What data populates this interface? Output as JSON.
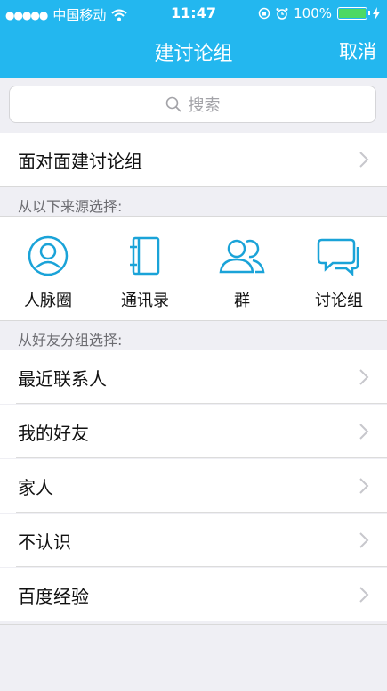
{
  "status_bar": {
    "carrier": "中国移动",
    "time": "11:47",
    "battery": "100%",
    "battery_level": 1.0
  },
  "nav": {
    "title": "建讨论组",
    "cancel": "取消"
  },
  "search": {
    "placeholder": "搜索"
  },
  "face_to_face": {
    "label": "面对面建讨论组"
  },
  "sources": {
    "header": "从以下来源选择:",
    "items": [
      {
        "label": "人脉圈",
        "icon": "contacts-circle-icon"
      },
      {
        "label": "通讯录",
        "icon": "address-book-icon"
      },
      {
        "label": "群",
        "icon": "group-icon"
      },
      {
        "label": "讨论组",
        "icon": "chat-bubbles-icon"
      }
    ]
  },
  "friends": {
    "header": "从好友分组选择:",
    "groups": [
      {
        "label": "最近联系人"
      },
      {
        "label": "我的好友"
      },
      {
        "label": "家人"
      },
      {
        "label": "不认识"
      },
      {
        "label": "百度经验"
      }
    ]
  },
  "colors": {
    "accent": "#23b7ef",
    "icon": "#1aa3d8",
    "background": "#efeff4"
  }
}
